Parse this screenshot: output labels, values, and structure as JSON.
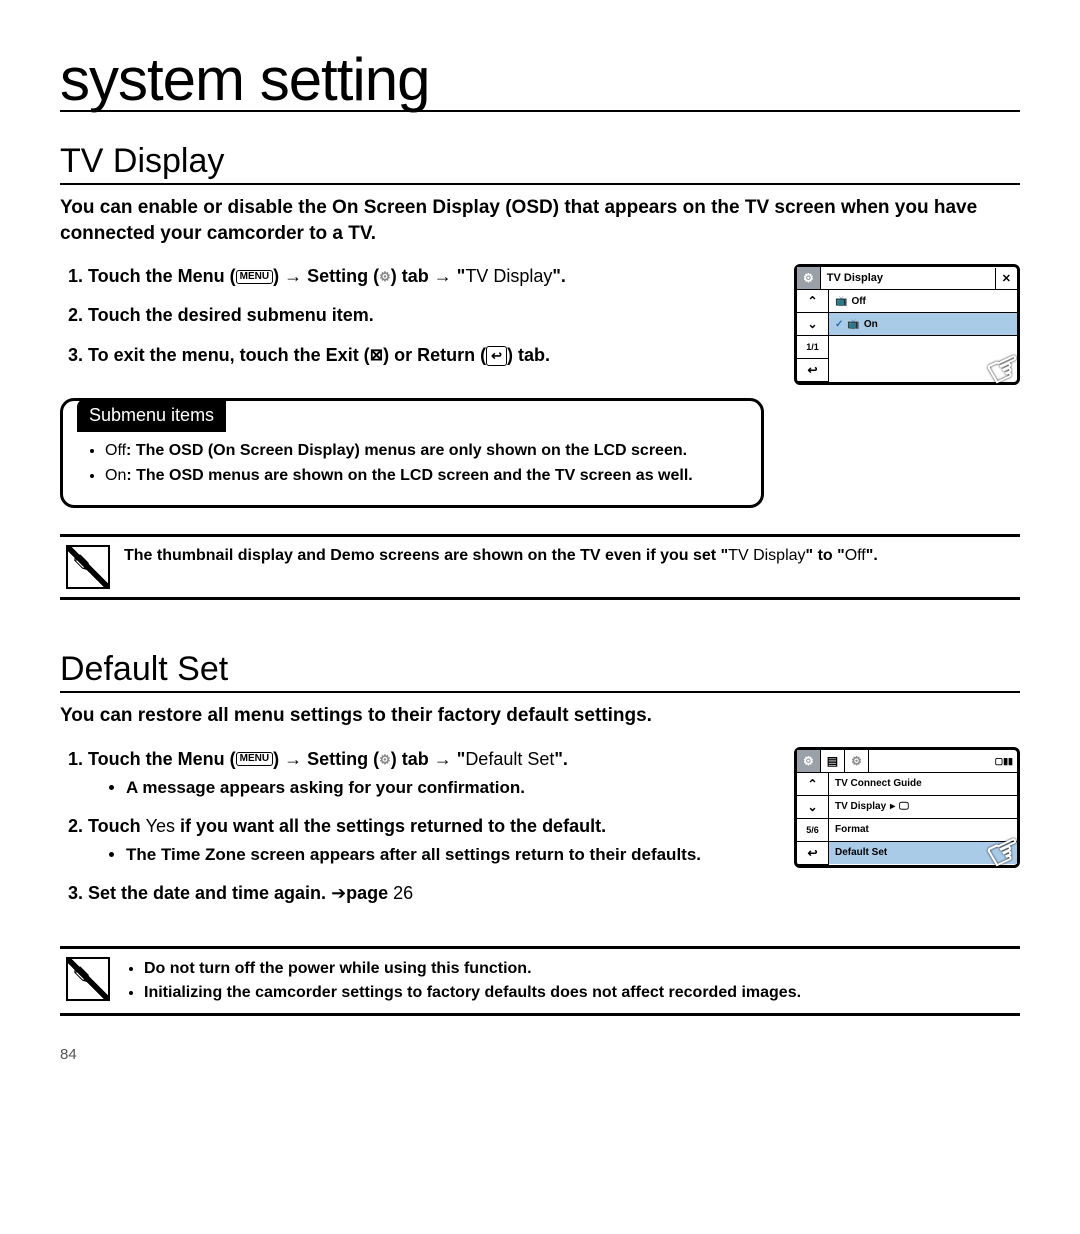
{
  "page": {
    "number": "84"
  },
  "chapter": {
    "title": "system setting"
  },
  "tv_display": {
    "heading": "TV Display",
    "intro": "You can enable or disable the On Screen Display (OSD) that appears on the TV screen when you have connected your camcorder to a TV.",
    "steps": {
      "s1_a": "Touch the Menu (",
      "s1_menu": "MENU",
      "s1_b": ") ",
      "s1_c": " Setting (",
      "s1_d": ") tab ",
      "s1_e": " \"",
      "s1_item": "TV Display",
      "s1_f": "\".",
      "s2": "Touch the desired submenu item.",
      "s3_a": "To exit the menu, touch the Exit (",
      "s3_b": ") or Return (",
      "s3_c": ") tab."
    },
    "submenu": {
      "title": "Submenu items",
      "off_label": "Off",
      "off_text": ": The OSD (On Screen Display) menus are only shown on the LCD screen.",
      "on_label": "On",
      "on_text": ": The OSD menus are shown on the LCD screen and the TV screen as well."
    },
    "note": {
      "a": "The thumbnail display and Demo screens are shown on the TV even if you set \"",
      "b": "TV Display",
      "c": "\" to \"",
      "d": "Off",
      "e": "\"."
    },
    "ui": {
      "title": "TV Display",
      "off": "Off",
      "on": "On",
      "page": "1/1"
    }
  },
  "default_set": {
    "heading": "Default Set",
    "intro": "You can restore all menu settings to their factory default settings.",
    "steps": {
      "s1_a": "Touch the Menu (",
      "s1_menu": "MENU",
      "s1_b": ") ",
      "s1_c": " Setting (",
      "s1_d": ") tab ",
      "s1_e": " \"",
      "s1_item": "Default Set",
      "s1_f": "\".",
      "s1_sub": "A message appears asking for your confirmation.",
      "s2_a": "Touch ",
      "s2_yes": "Yes",
      "s2_b": " if you want all the settings returned to the default.",
      "s2_sub": "The Time Zone screen appears after all settings return to their defaults.",
      "s3_a": "Set the date and time again. ",
      "s3_arrow": "➔",
      "s3_b": "page ",
      "s3_page": "26"
    },
    "notes": {
      "n1": "Do not turn off the power while using this function.",
      "n2": "Initializing the camcorder settings to factory defaults does not affect recorded images."
    },
    "ui": {
      "r1": "TV Connect Guide",
      "r2": "TV Display",
      "r3": "Format",
      "r4": "Default Set",
      "page": "5/6"
    }
  }
}
